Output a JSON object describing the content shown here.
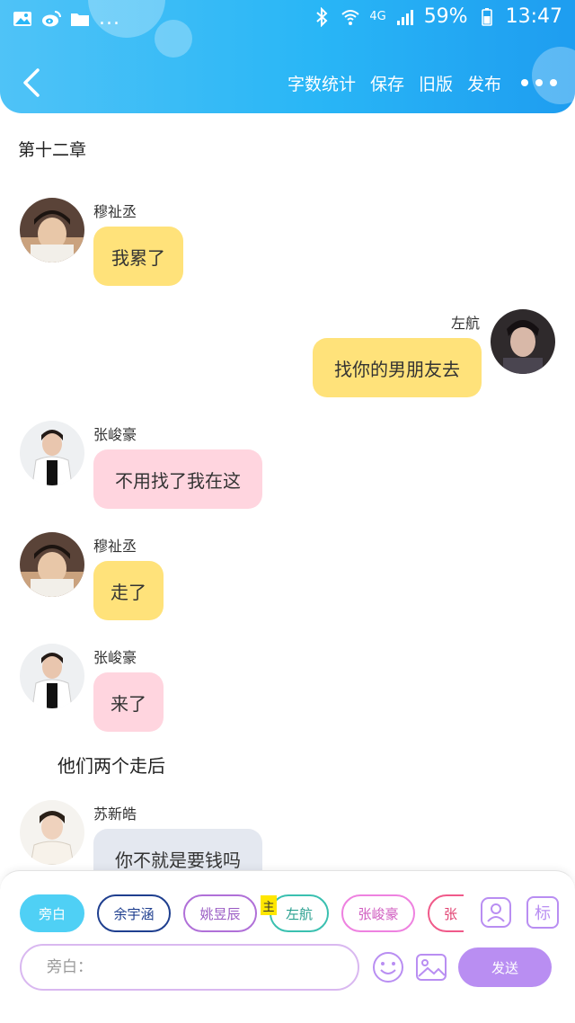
{
  "status_bar": {
    "battery": "59%",
    "time": "13:47",
    "network": "4G",
    "more": "..."
  },
  "header": {
    "actions": [
      "字数统计",
      "保存",
      "旧版",
      "发布"
    ],
    "colors": {
      "gradient_start": "#4fc3f7",
      "gradient_end": "#1e9df0"
    }
  },
  "chapter_title": "第十二章",
  "messages": [
    {
      "sender": "穆祉丞",
      "text": "我累了",
      "side": "left",
      "bubble_color": "yellow"
    },
    {
      "sender": "左航",
      "text": "找你的男朋友去",
      "side": "right",
      "bubble_color": "yellow"
    },
    {
      "sender": "张峻豪",
      "text": "不用找了我在这",
      "side": "left",
      "bubble_color": "pink"
    },
    {
      "sender": "穆祉丞",
      "text": "走了",
      "side": "left",
      "bubble_color": "yellow"
    },
    {
      "sender": "张峻豪",
      "text": "来了",
      "side": "left",
      "bubble_color": "pink"
    },
    {
      "sender": "苏新皓",
      "text": "你不就是要钱吗",
      "side": "left",
      "bubble_color": "gray"
    }
  ],
  "narration": "他们两个走后",
  "panel": {
    "characters": [
      {
        "name": "旁白",
        "color": "#4fd0f5",
        "active": true
      },
      {
        "name": "余宇涵",
        "color": "#1f3f8f",
        "active": false
      },
      {
        "name": "姚昱辰",
        "color": "#b070d8",
        "active": false
      },
      {
        "name": "左航",
        "color": "#3ac0b0",
        "active": false
      },
      {
        "name": "张峻豪",
        "color": "#ee82e0",
        "active": false
      },
      {
        "name": "张",
        "color": "#f05a8a",
        "active": false
      }
    ],
    "main_badge": "主",
    "tool_icons": [
      "character-manager-icon",
      "tag-icon"
    ],
    "tag_label": "标",
    "input_placeholder": "旁白：",
    "send_label": "发送",
    "colors": {
      "input_border": "#d9b8f0",
      "send_bg": "#b98ef2"
    }
  }
}
